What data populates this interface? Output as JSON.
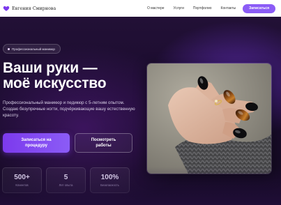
{
  "header": {
    "brand_name": "Евгения Смирнова",
    "nav": [
      "О мастере",
      "Услуги",
      "Портфолио",
      "Контакты"
    ],
    "cta": "Записаться"
  },
  "hero": {
    "badge": "Профессиональный маникюр",
    "title_line1": "Ваши руки —",
    "title_line2": "моё искусство",
    "subtitle": "Профессиональный маникюр и педикюр с 5-летним опытом. Создаю безупречные ногти, подчёркивающие вашу естественную красоту.",
    "primary_button_line1": "Записаться на",
    "primary_button_line2": "процедуру",
    "secondary_button_line1": "Посмотреть",
    "secondary_button_line2": "работы"
  },
  "stats": [
    {
      "value": "500+",
      "label": "Клиентов"
    },
    {
      "value": "5",
      "label": "Лет опыта"
    },
    {
      "value": "100%",
      "label": "Безопасность"
    }
  ],
  "colors": {
    "accent": "#8b5cf6",
    "background": "#140b22"
  },
  "icons": {
    "brand": "heart-icon",
    "badge": "sparkle-dot-icon"
  }
}
